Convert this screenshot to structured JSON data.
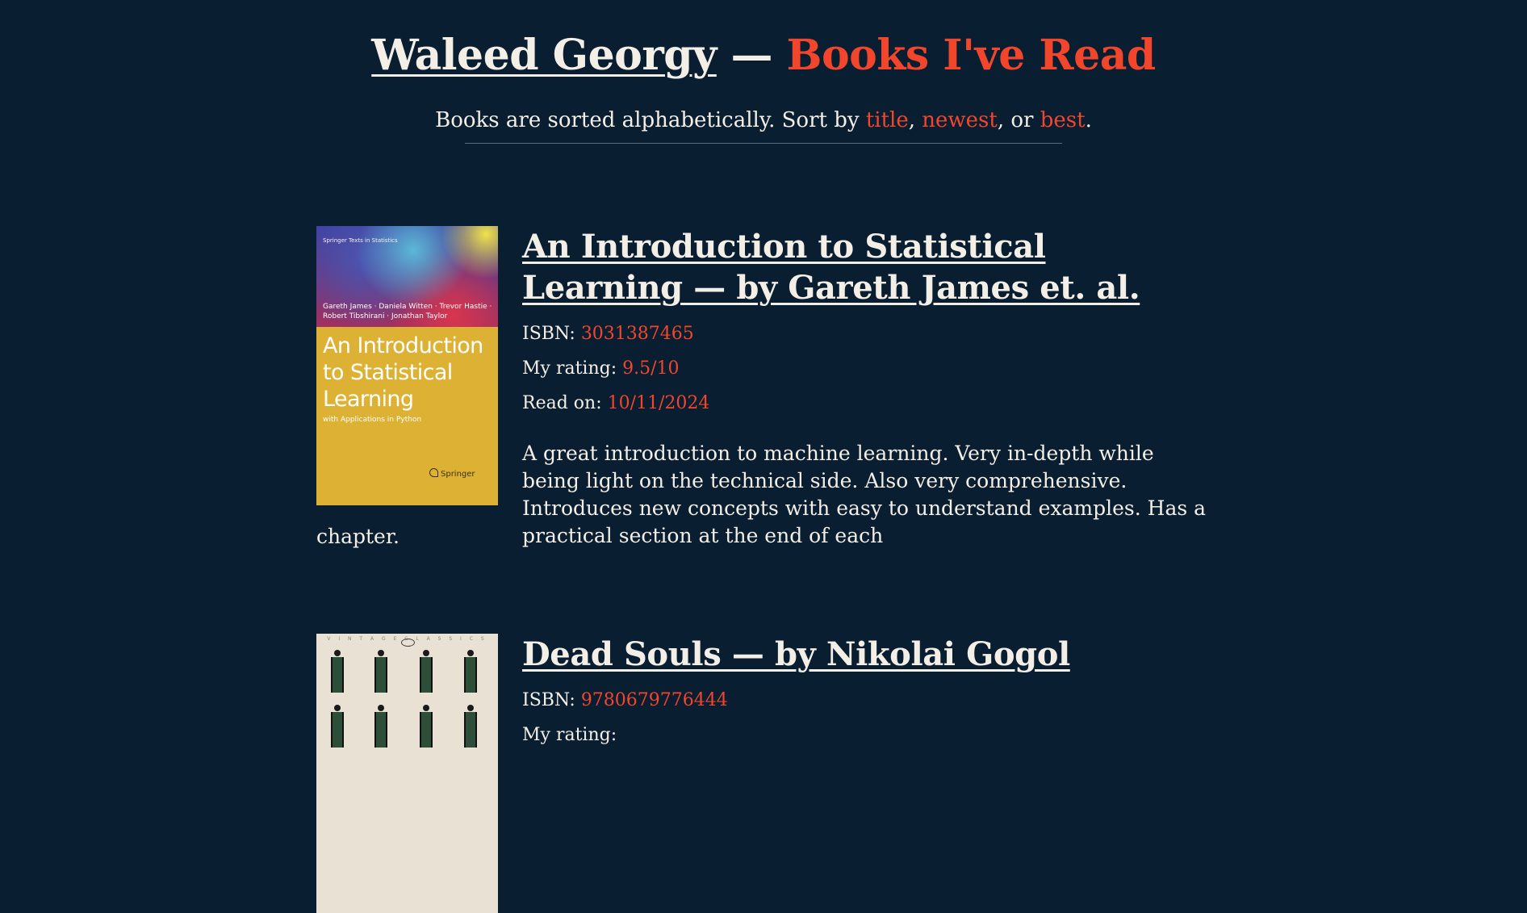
{
  "header": {
    "author_name": "Waleed Georgy",
    "separator": "—",
    "section_title": "Books I've Read"
  },
  "sort_bar": {
    "prefix": "Books are sorted alphabetically. Sort by",
    "options": [
      "title",
      "newest",
      "best"
    ],
    "sep1": ",",
    "sep2": ", or",
    "suffix": "."
  },
  "labels": {
    "isbn": "ISBN:",
    "rating": "My rating:",
    "read_on": "Read on:"
  },
  "books": [
    {
      "title": "An Introduction to Statistical Learning — by Gareth James et. al.",
      "isbn": "3031387465",
      "rating": "9.5/10",
      "read_on": "10/11/2024",
      "review_lines": "A great introduction to machine learning. Very in-depth while being light on the technical side. Also very comprehensive. Introduces new concepts with easy to understand examples. Has a practical section at the end of each",
      "review_tail": "chapter.",
      "cover": {
        "series": "Springer Texts in Statistics",
        "authors": "Gareth James · Daniela Witten · Trevor Hastie · Robert Tibshirani · Jonathan Taylor",
        "title": "An Introduction to Statistical Learning",
        "subtitle": "with Applications in Python",
        "publisher": "Springer"
      }
    },
    {
      "title": "Dead Souls — by Nikolai Gogol",
      "isbn": "9780679776444",
      "rating": "",
      "cover": {
        "band_text": "V I N T A G E   C L A S S I C S"
      }
    }
  ],
  "colors": {
    "background": "#0a1e31",
    "text": "#f4efe6",
    "accent": "#f2462c",
    "rule": "#5a6c7d"
  }
}
